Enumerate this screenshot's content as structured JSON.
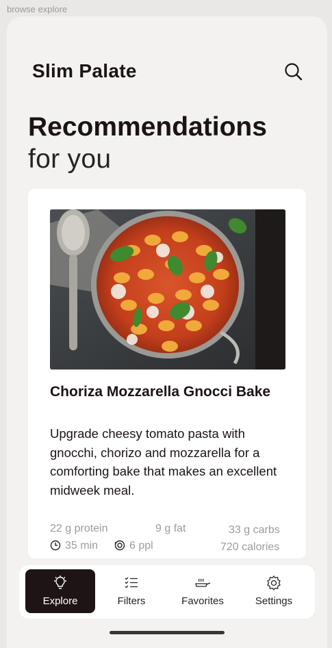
{
  "frame_label": "browse explore",
  "header": {
    "brand": "Slim Palate",
    "search_icon": "search-icon"
  },
  "heading": {
    "line1": "Recommendations",
    "line2": "for you"
  },
  "recipe": {
    "title": "Choriza Mozzarella Gnocci Bake",
    "description": "Upgrade cheesy tomato pasta with gnocchi, chorizo and mozzarella for a comforting bake that makes an excellent midweek meal.",
    "protein": "22 g protein",
    "fat": "9 g fat",
    "carbs": "33 g carbs",
    "time": "35 min",
    "servings": "6 ppl",
    "calories": "720 calories"
  },
  "nav": {
    "items": [
      {
        "label": "Explore",
        "icon": "lightbulb-icon",
        "active": true
      },
      {
        "label": "Filters",
        "icon": "checklist-icon",
        "active": false
      },
      {
        "label": "Favorites",
        "icon": "pan-icon",
        "active": false
      },
      {
        "label": "Settings",
        "icon": "gear-icon",
        "active": false
      }
    ]
  },
  "colors": {
    "background": "#f3f2f0",
    "card": "#ffffff",
    "accent_dark": "#1e1416",
    "muted_text": "#9e9a9a"
  }
}
